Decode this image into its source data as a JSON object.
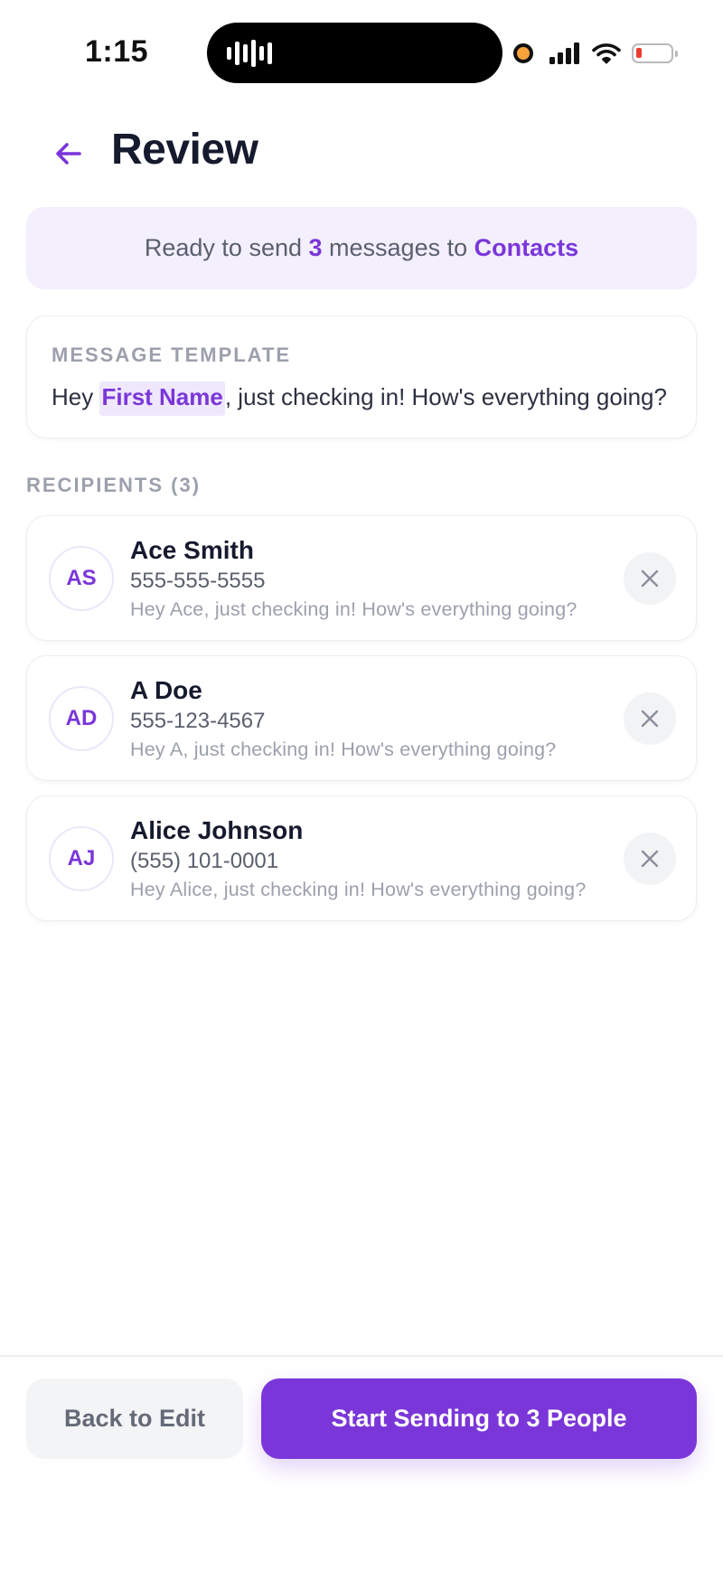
{
  "status_bar": {
    "time": "1:15",
    "battery_level": 0.15,
    "battery_color": "#ea3d2f"
  },
  "header": {
    "back_icon": "arrow-left-icon",
    "title": "Review"
  },
  "summary": {
    "prefix": "Ready to send ",
    "count": "3",
    "middle": " messages to ",
    "list_name": "Contacts"
  },
  "template": {
    "label": "MESSAGE TEMPLATE",
    "before": "Hey ",
    "placeholder": "First Name",
    "after": ", just checking in! How's everything going?"
  },
  "recipients": {
    "label": "RECIPIENTS (3)",
    "items": [
      {
        "initials": "AS",
        "name": "Ace Smith",
        "phone": "555-555-5555",
        "preview": "Hey Ace, just checking in! How's everything going?"
      },
      {
        "initials": "AD",
        "name": "A Doe",
        "phone": "555-123-4567",
        "preview": "Hey A, just checking in! How's everything going?"
      },
      {
        "initials": "AJ",
        "name": "Alice Johnson",
        "phone": "(555) 101-0001",
        "preview": "Hey Alice, just checking in! How's everything going?"
      }
    ]
  },
  "actions": {
    "back_label": "Back to Edit",
    "send_label": "Start Sending to 3 People"
  },
  "colors": {
    "accent": "#7a36d9",
    "banner_bg": "#f3effd",
    "title": "#161a2e"
  }
}
